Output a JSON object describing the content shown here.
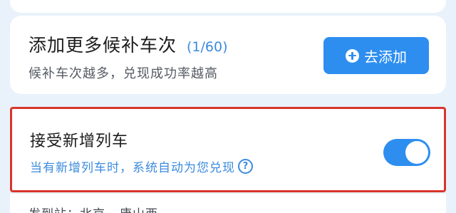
{
  "add_more": {
    "title": "添加更多候补车次",
    "count": "(1/60)",
    "subtitle": "候补车次越多，兑现成功率越高",
    "button_label": "去添加",
    "button_icon": "plus-circle-icon"
  },
  "accept_new_trains": {
    "title": "接受新增列车",
    "description": "当有新增列车时，系统自动为您兑现",
    "help_icon": "question-circle-icon",
    "help_symbol": "?",
    "toggle_on": true
  },
  "route": {
    "text": "发到站：北京 - 唐山西"
  },
  "colors": {
    "background": "#e9f2fb",
    "accent": "#2d8ef0",
    "link_text": "#3b8bde",
    "highlight_border": "#d8352c"
  }
}
